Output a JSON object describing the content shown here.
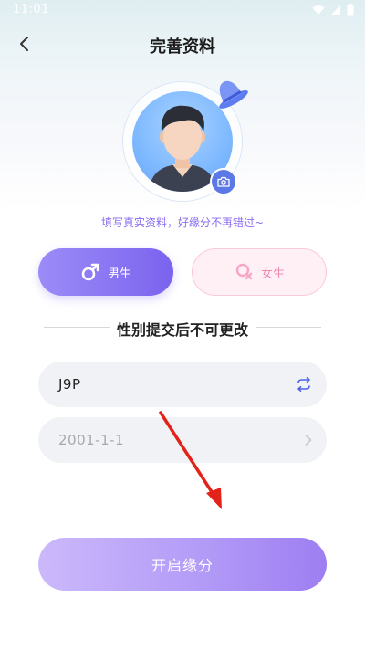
{
  "status_bar": {
    "time": "11:01"
  },
  "header": {
    "title": "完善资料"
  },
  "avatar": {
    "hint": "填写真实资料，好缘分不再错过~"
  },
  "gender": {
    "male_label": "男生",
    "female_label": "女生",
    "selected": "male",
    "notice": "性别提交后不可更改"
  },
  "form": {
    "nickname_value": "J9P",
    "birthday_value": "2001-1-1"
  },
  "submit": {
    "label": "开启缘分"
  },
  "colors": {
    "accent": "#7b63ee",
    "hint_text": "#8a6cf0",
    "female_text": "#f088b4",
    "annotation_arrow": "#e2231a"
  }
}
